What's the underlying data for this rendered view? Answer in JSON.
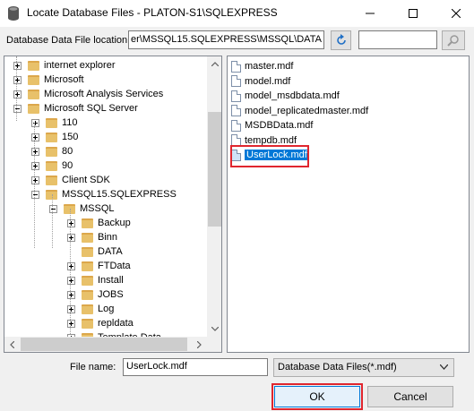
{
  "window": {
    "title": "Locate Database Files - PLATON-S1\\SQLEXPRESS",
    "icons": {
      "app": "database-icon",
      "minimize": "minimize-icon",
      "maximize": "maximize-icon",
      "close": "close-icon"
    }
  },
  "location": {
    "label": "Database Data File location:",
    "path_value": "er\\MSSQL15.SQLEXPRESS\\MSSQL\\DATA",
    "search_value": "",
    "refresh_icon": "refresh-icon",
    "search_icon": "search-icon"
  },
  "tree": {
    "items": [
      {
        "label": "internet explorer",
        "level": 0,
        "expander": "plus"
      },
      {
        "label": "Microsoft",
        "level": 0,
        "expander": "plus"
      },
      {
        "label": "Microsoft Analysis Services",
        "level": 0,
        "expander": "plus"
      },
      {
        "label": "Microsoft SQL Server",
        "level": 0,
        "expander": "minus"
      },
      {
        "label": "110",
        "level": 1,
        "expander": "plus"
      },
      {
        "label": "150",
        "level": 1,
        "expander": "plus"
      },
      {
        "label": "80",
        "level": 1,
        "expander": "plus"
      },
      {
        "label": "90",
        "level": 1,
        "expander": "plus"
      },
      {
        "label": "Client SDK",
        "level": 1,
        "expander": "plus"
      },
      {
        "label": "MSSQL15.SQLEXPRESS",
        "level": 1,
        "expander": "minus"
      },
      {
        "label": "MSSQL",
        "level": 2,
        "expander": "minus"
      },
      {
        "label": "Backup",
        "level": 3,
        "expander": "plus"
      },
      {
        "label": "Binn",
        "level": 3,
        "expander": "plus"
      },
      {
        "label": "DATA",
        "level": 3,
        "expander": "none"
      },
      {
        "label": "FTData",
        "level": 3,
        "expander": "plus"
      },
      {
        "label": "Install",
        "level": 3,
        "expander": "plus"
      },
      {
        "label": "JOBS",
        "level": 3,
        "expander": "plus"
      },
      {
        "label": "Log",
        "level": 3,
        "expander": "plus"
      },
      {
        "label": "repldata",
        "level": 3,
        "expander": "plus"
      },
      {
        "label": "Template Data",
        "level": 3,
        "expander": "plus"
      }
    ]
  },
  "files": {
    "items": [
      {
        "name": "master.mdf"
      },
      {
        "name": "model.mdf"
      },
      {
        "name": "model_msdbdata.mdf"
      },
      {
        "name": "model_replicatedmaster.mdf"
      },
      {
        "name": "MSDBData.mdf"
      },
      {
        "name": "tempdb.mdf"
      },
      {
        "name": "UserLock.mdf",
        "selected": true
      }
    ]
  },
  "footer": {
    "file_name_label": "File name:",
    "file_name_value": "UserLock.mdf",
    "file_type_value": "Database Data Files(*.mdf)",
    "ok_label": "OK",
    "cancel_label": "Cancel"
  },
  "colors": {
    "selection": "#0078d7",
    "highlight_outline": "#e0262e",
    "folder": "#e8c16a"
  }
}
